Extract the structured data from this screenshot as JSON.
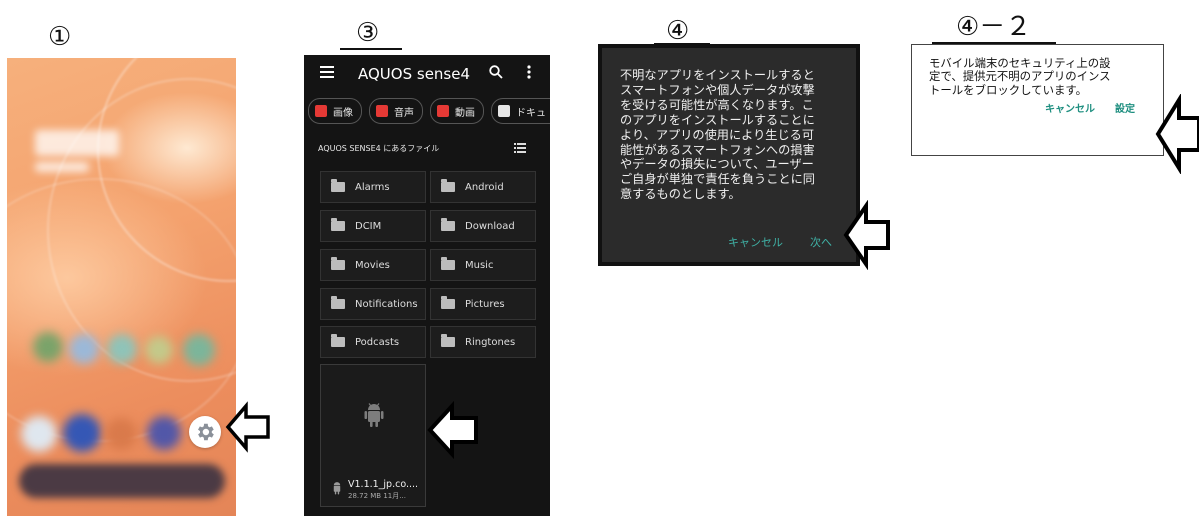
{
  "labels": {
    "step1": "①",
    "step3": "③",
    "step4": "④",
    "step4_2": "④－２"
  },
  "panel3": {
    "app_title": "AQUOS sense4",
    "menu_icon": "hamburger-menu-icon",
    "search_icon": "search-icon",
    "more_icon": "more-vert-icon",
    "chips": [
      {
        "label": "画像",
        "icon": "image-icon",
        "color": "#e53935"
      },
      {
        "label": "音声",
        "icon": "audio-icon",
        "color": "#e53935"
      },
      {
        "label": "動画",
        "icon": "video-icon",
        "color": "#e53935"
      },
      {
        "label": "ドキュ",
        "icon": "document-icon",
        "color": "#e6e6e6"
      }
    ],
    "section_title": "AQUOS SENSE4 にあるファイル",
    "view_toggle_icon": "list-view-icon",
    "folders": [
      "Alarms",
      "Android",
      "DCIM",
      "Download",
      "Movies",
      "Music",
      "Notifications",
      "Pictures",
      "Podcasts",
      "Ringtones"
    ],
    "apk": {
      "name": "V1.1.1_jp.co....",
      "meta": "28.72 MB 11月...",
      "icon": "android-icon"
    }
  },
  "panel4": {
    "message_lines": [
      "不明なアプリをインストールすると",
      "スマートフォンや個人データが攻撃",
      "を受ける可能性が高くなります。こ",
      "のアプリをインストールすることに",
      "より、アプリの使用により生じる可",
      "能性があるスマートフォンへの損害",
      "やデータの損失について、ユーザー",
      "ご自身が単独で責任を負うことに同",
      "意するものとします。"
    ],
    "cancel_label": "キャンセル",
    "next_label": "次へ"
  },
  "panel4_2": {
    "message_lines": [
      "モバイル端末のセキュリティ上の設",
      "定で、提供元不明のアプリのインス",
      "トールをブロックしています。"
    ],
    "cancel_label": "キャンセル",
    "settings_label": "設定"
  },
  "colors": {
    "accent_teal_dark": "#3fb1a5",
    "accent_teal_light": "#1f8f80",
    "chip_red": "#e53935"
  }
}
